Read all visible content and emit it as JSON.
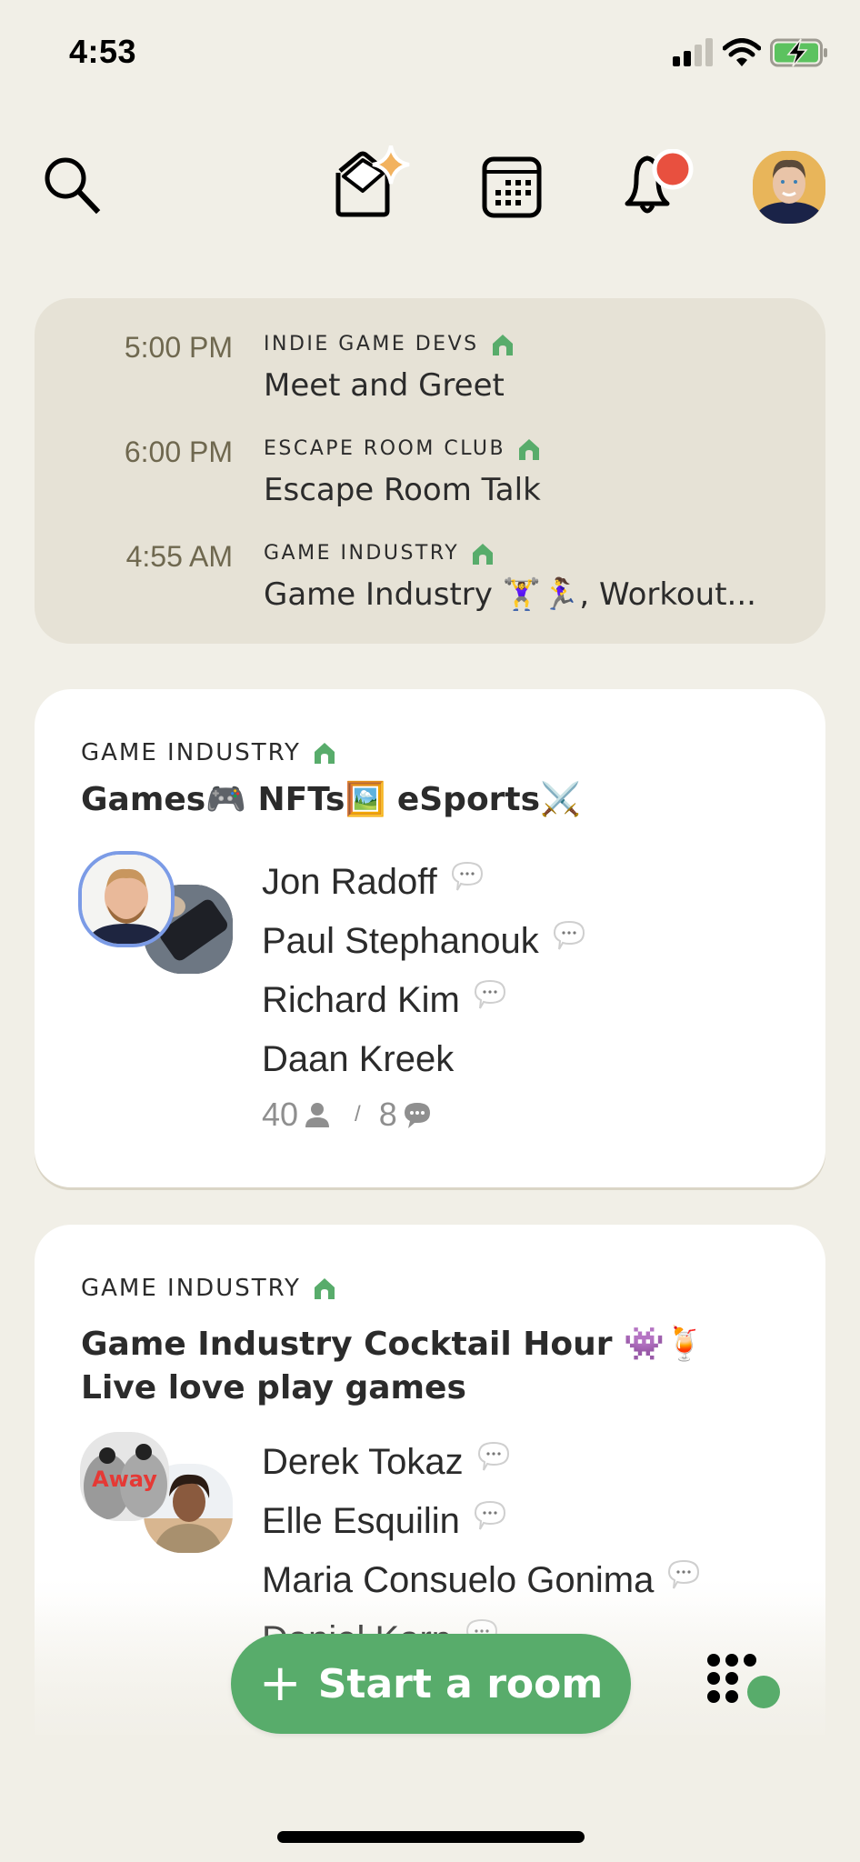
{
  "status_bar": {
    "time": "4:53",
    "signal_icon": "cellular-signal-icon",
    "wifi_icon": "wifi-icon",
    "battery_icon": "battery-charging-icon"
  },
  "header": {
    "search_icon": "search-icon",
    "invite_icon": "envelope-sparkle-icon",
    "calendar_icon": "calendar-icon",
    "notifications_icon": "bell-icon",
    "notification_badge_color": "#E8503F",
    "profile_icon": "avatar"
  },
  "upcoming": [
    {
      "time": "5:00 PM",
      "club": "INDIE GAME DEVS",
      "title": "Meet and Greet"
    },
    {
      "time": "6:00 PM",
      "club": "ESCAPE ROOM CLUB",
      "title": "Escape Room Talk"
    },
    {
      "time": "4:55 AM",
      "club": "GAME INDUSTRY",
      "title": "Game Industry 🏋️‍♀️🏃‍♀️, Workout..."
    }
  ],
  "rooms": [
    {
      "club": "GAME INDUSTRY",
      "title": "Games🎮 NFTs🖼️ eSports⚔️",
      "speakers": [
        {
          "name": "Jon Radoff",
          "has_bubble": true
        },
        {
          "name": "Paul Stephanouk",
          "has_bubble": true
        },
        {
          "name": "Richard Kim",
          "has_bubble": true
        },
        {
          "name": "Daan Kreek",
          "has_bubble": false
        }
      ],
      "listeners": "40",
      "separator": "/",
      "speakers_count": "8"
    },
    {
      "club": "GAME INDUSTRY",
      "title": "Game Industry Cocktail Hour 👾🍹 Live love play games",
      "speakers": [
        {
          "name": "Derek Tokaz",
          "has_bubble": true
        },
        {
          "name": "Elle Esquilin",
          "has_bubble": true
        },
        {
          "name": "Maria Consuelo Gonima",
          "has_bubble": true
        },
        {
          "name": "Daniel Karp",
          "has_bubble": true
        }
      ]
    }
  ],
  "actions": {
    "start_room_plus": "+",
    "start_room_label": "Start a room",
    "grid_icon": "dots-grid-icon"
  },
  "colors": {
    "background": "#F1EFE7",
    "upcoming_bg": "#E6E2D6",
    "accent_green": "#58AC6B",
    "speaking_ring": "#7B9BE6"
  }
}
